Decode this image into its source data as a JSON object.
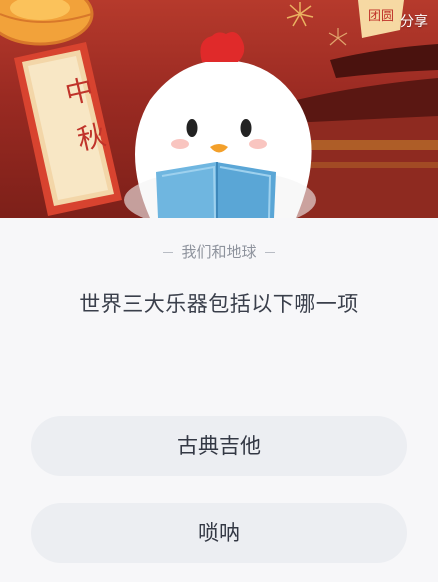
{
  "header": {
    "share_label": "分享",
    "banner_text": "中秋",
    "badge_text": "团圆"
  },
  "quiz": {
    "subtitle": "我们和地球",
    "question": "世界三大乐器包括以下哪一项",
    "options": [
      {
        "label": "古典吉他"
      },
      {
        "label": "唢呐"
      }
    ]
  },
  "colors": {
    "hero_red": "#a8302a",
    "lantern_orange": "#f2a23a",
    "banner_red": "#d8432f",
    "page_bg": "#f7f7f9",
    "option_bg": "#eceef2",
    "text_dark": "#3a3f4b",
    "text_muted": "#8e939d"
  }
}
